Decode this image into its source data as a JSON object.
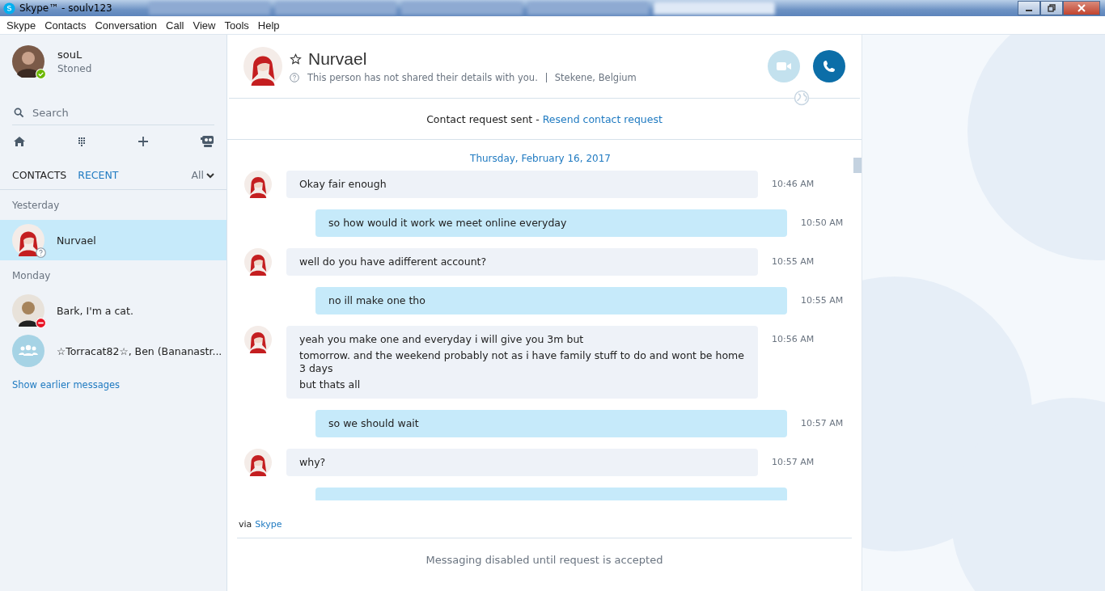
{
  "window": {
    "title": "Skype™ - soulv123"
  },
  "menu": [
    "Skype",
    "Contacts",
    "Conversation",
    "Call",
    "View",
    "Tools",
    "Help"
  ],
  "profile": {
    "name": "souL",
    "mood": "Stoned"
  },
  "search": {
    "placeholder": "Search"
  },
  "tabs": [
    {
      "label": "CONTACTS",
      "selected": false
    },
    {
      "label": "RECENT",
      "selected": true
    }
  ],
  "filter": "All",
  "recent": [
    {
      "heading": "Yesterday",
      "items": [
        {
          "name": "Nurvael",
          "selected": true,
          "kind": "pending"
        }
      ]
    },
    {
      "heading": "Monday",
      "items": [
        {
          "name": "Bark, I'm a cat.",
          "selected": false,
          "kind": "busy"
        },
        {
          "name": "☆Torracat82☆, Ben (Bananastr...",
          "selected": false,
          "kind": "group"
        }
      ]
    }
  ],
  "show_earlier": "Show earlier messages",
  "contact": {
    "name": "Nurvael",
    "details": "This person has not shared their details with you.",
    "location": "Stekene, Belgium"
  },
  "request": {
    "text": "Contact request sent - ",
    "link": "Resend contact request"
  },
  "messages": [
    {
      "kind": "date",
      "text": "Thursday, February 16, 2017"
    },
    {
      "kind": "in",
      "lines": [
        "Okay fair enough"
      ],
      "time": "10:46 AM"
    },
    {
      "kind": "out",
      "lines": [
        "so how would it work  we meet online everyday"
      ],
      "time": "10:50 AM"
    },
    {
      "kind": "in",
      "lines": [
        "well do you have  adifferent account?"
      ],
      "time": "10:55 AM"
    },
    {
      "kind": "out",
      "lines": [
        "no ill make one tho"
      ],
      "time": "10:55 AM"
    },
    {
      "kind": "in",
      "lines": [
        "yeah you make one and everyday i will give you 3m but",
        "tomorrow. and the weekend probably not as i have family stuff to do and wont be home 3 days",
        "but thats all"
      ],
      "time": "10:56 AM"
    },
    {
      "kind": "out",
      "lines": [
        "so we should wait"
      ],
      "time": "10:57 AM"
    },
    {
      "kind": "in",
      "lines": [
        "why?"
      ],
      "time": "10:57 AM"
    },
    {
      "kind": "out"
    }
  ],
  "via": {
    "text": "via",
    "link": "Skype"
  },
  "composer": {
    "notice": "Messaging disabled until request is accepted"
  }
}
